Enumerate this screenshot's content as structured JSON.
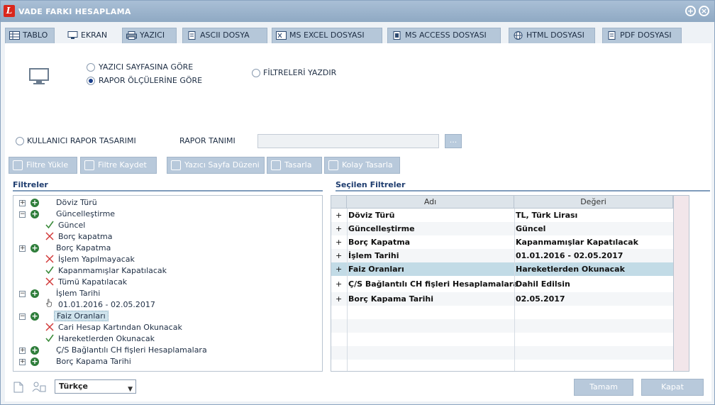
{
  "window": {
    "title": "VADE FARKI HESAPLAMA"
  },
  "tabs": [
    {
      "label": "TABLO"
    },
    {
      "label": "EKRAN"
    },
    {
      "label": "YAZICI"
    },
    {
      "label": "ASCII DOSYA"
    },
    {
      "label": "MS EXCEL DOSYASI"
    },
    {
      "label": "MS ACCESS DOSYASI"
    },
    {
      "label": "HTML DOSYASI"
    },
    {
      "label": "PDF DOSYASI"
    }
  ],
  "options": {
    "radio_printer": "YAZICI SAYFASINA GÖRE",
    "radio_report": "RAPOR ÖLÇÜLERİNE GÖRE",
    "radio_selected": "report",
    "print_filters": "FİLTRELERİ YAZDIR"
  },
  "report": {
    "user_design": "KULLANICI RAPOR TASARIMI",
    "definition_label": "RAPOR TANIMI",
    "definition_value": "",
    "dots": "..."
  },
  "toolbar": {
    "load_filter": "Filtre Yükle",
    "save_filter": "Filtre Kaydet",
    "page_setup": "Yazıcı Sayfa Düzeni",
    "design": "Tasarla",
    "easy_design": "Kolay Tasarla"
  },
  "filters": {
    "title": "Filtreler",
    "items": [
      {
        "label": "Döviz Türü",
        "expander": "+"
      },
      {
        "label": "Güncelleştirme",
        "expander": "−"
      },
      {
        "label": "Güncel",
        "state": "check"
      },
      {
        "label": "Borç kapatma",
        "state": "cross"
      },
      {
        "label": "Borç Kapatma",
        "expander": "+"
      },
      {
        "label": "İşlem Yapılmayacak",
        "state": "cross"
      },
      {
        "label": "Kapanmamışlar Kapatılacak",
        "state": "check"
      },
      {
        "label": "Tümü Kapatılacak",
        "state": "cross"
      },
      {
        "label": "İşlem Tarihi",
        "expander": "−"
      },
      {
        "label": "01.01.2016 - 02.05.2017",
        "state": "hand"
      },
      {
        "label": "Faiz Oranları",
        "expander": "−"
      },
      {
        "label": "Cari Hesap Kartından Okunacak",
        "state": "cross"
      },
      {
        "label": "Hareketlerden Okunacak",
        "state": "check"
      },
      {
        "label": "Ç/S Bağlantılı CH fişleri Hesaplamalara",
        "expander": "+"
      },
      {
        "label": "Borç Kapama Tarihi",
        "expander": "+"
      }
    ]
  },
  "selected": {
    "title": "Seçilen Filtreler",
    "columns": [
      "Adı",
      "Değeri"
    ],
    "rows": [
      {
        "marker": "+",
        "name": "Döviz Türü",
        "value": "TL, Türk Lirası"
      },
      {
        "marker": "+",
        "name": "Güncelleştirme",
        "value": "Güncel"
      },
      {
        "marker": "+",
        "name": "Borç Kapatma",
        "value": "Kapanmamışlar Kapatılacak"
      },
      {
        "marker": "+",
        "name": "İşlem Tarihi",
        "value": "01.01.2016 - 02.05.2017"
      },
      {
        "marker": "+",
        "name": "Faiz Oranları",
        "value": "Hareketlerden Okunacak"
      },
      {
        "marker": "+",
        "name": "Ç/S Bağlantılı CH fişleri Hesaplamalara",
        "value": "Dahil Edilsin"
      },
      {
        "marker": "+",
        "name": "Borç Kapama Tarihi",
        "value": "02.05.2017"
      }
    ]
  },
  "footer": {
    "language": "Türkçe",
    "ok": "Tamam",
    "close": "Kapat"
  },
  "colors": {
    "title_bar": "#98b1ca",
    "accent": "#1e3c6e",
    "selected_row": "#c2dbe6"
  }
}
